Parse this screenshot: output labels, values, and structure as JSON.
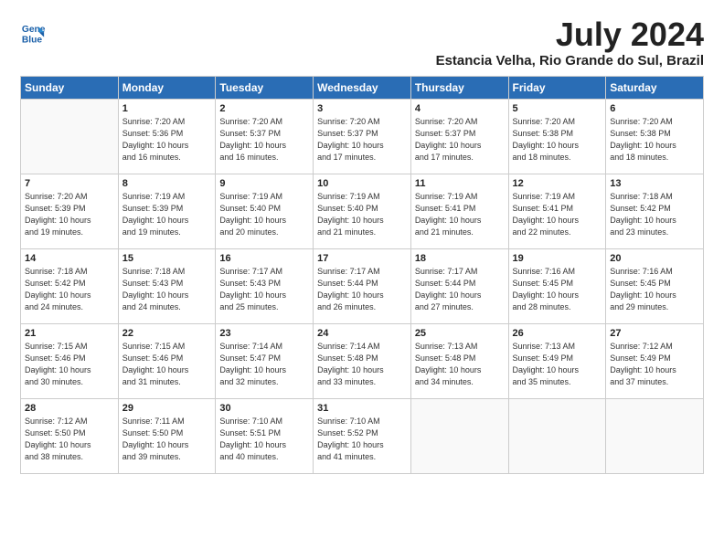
{
  "header": {
    "logo_line1": "General",
    "logo_line2": "Blue",
    "title": "July 2024",
    "location": "Estancia Velha, Rio Grande do Sul, Brazil"
  },
  "weekdays": [
    "Sunday",
    "Monday",
    "Tuesday",
    "Wednesday",
    "Thursday",
    "Friday",
    "Saturday"
  ],
  "weeks": [
    [
      {
        "day": "",
        "info": ""
      },
      {
        "day": "1",
        "info": "Sunrise: 7:20 AM\nSunset: 5:36 PM\nDaylight: 10 hours\nand 16 minutes."
      },
      {
        "day": "2",
        "info": "Sunrise: 7:20 AM\nSunset: 5:37 PM\nDaylight: 10 hours\nand 16 minutes."
      },
      {
        "day": "3",
        "info": "Sunrise: 7:20 AM\nSunset: 5:37 PM\nDaylight: 10 hours\nand 17 minutes."
      },
      {
        "day": "4",
        "info": "Sunrise: 7:20 AM\nSunset: 5:37 PM\nDaylight: 10 hours\nand 17 minutes."
      },
      {
        "day": "5",
        "info": "Sunrise: 7:20 AM\nSunset: 5:38 PM\nDaylight: 10 hours\nand 18 minutes."
      },
      {
        "day": "6",
        "info": "Sunrise: 7:20 AM\nSunset: 5:38 PM\nDaylight: 10 hours\nand 18 minutes."
      }
    ],
    [
      {
        "day": "7",
        "info": "Sunrise: 7:20 AM\nSunset: 5:39 PM\nDaylight: 10 hours\nand 19 minutes."
      },
      {
        "day": "8",
        "info": "Sunrise: 7:19 AM\nSunset: 5:39 PM\nDaylight: 10 hours\nand 19 minutes."
      },
      {
        "day": "9",
        "info": "Sunrise: 7:19 AM\nSunset: 5:40 PM\nDaylight: 10 hours\nand 20 minutes."
      },
      {
        "day": "10",
        "info": "Sunrise: 7:19 AM\nSunset: 5:40 PM\nDaylight: 10 hours\nand 21 minutes."
      },
      {
        "day": "11",
        "info": "Sunrise: 7:19 AM\nSunset: 5:41 PM\nDaylight: 10 hours\nand 21 minutes."
      },
      {
        "day": "12",
        "info": "Sunrise: 7:19 AM\nSunset: 5:41 PM\nDaylight: 10 hours\nand 22 minutes."
      },
      {
        "day": "13",
        "info": "Sunrise: 7:18 AM\nSunset: 5:42 PM\nDaylight: 10 hours\nand 23 minutes."
      }
    ],
    [
      {
        "day": "14",
        "info": "Sunrise: 7:18 AM\nSunset: 5:42 PM\nDaylight: 10 hours\nand 24 minutes."
      },
      {
        "day": "15",
        "info": "Sunrise: 7:18 AM\nSunset: 5:43 PM\nDaylight: 10 hours\nand 24 minutes."
      },
      {
        "day": "16",
        "info": "Sunrise: 7:17 AM\nSunset: 5:43 PM\nDaylight: 10 hours\nand 25 minutes."
      },
      {
        "day": "17",
        "info": "Sunrise: 7:17 AM\nSunset: 5:44 PM\nDaylight: 10 hours\nand 26 minutes."
      },
      {
        "day": "18",
        "info": "Sunrise: 7:17 AM\nSunset: 5:44 PM\nDaylight: 10 hours\nand 27 minutes."
      },
      {
        "day": "19",
        "info": "Sunrise: 7:16 AM\nSunset: 5:45 PM\nDaylight: 10 hours\nand 28 minutes."
      },
      {
        "day": "20",
        "info": "Sunrise: 7:16 AM\nSunset: 5:45 PM\nDaylight: 10 hours\nand 29 minutes."
      }
    ],
    [
      {
        "day": "21",
        "info": "Sunrise: 7:15 AM\nSunset: 5:46 PM\nDaylight: 10 hours\nand 30 minutes."
      },
      {
        "day": "22",
        "info": "Sunrise: 7:15 AM\nSunset: 5:46 PM\nDaylight: 10 hours\nand 31 minutes."
      },
      {
        "day": "23",
        "info": "Sunrise: 7:14 AM\nSunset: 5:47 PM\nDaylight: 10 hours\nand 32 minutes."
      },
      {
        "day": "24",
        "info": "Sunrise: 7:14 AM\nSunset: 5:48 PM\nDaylight: 10 hours\nand 33 minutes."
      },
      {
        "day": "25",
        "info": "Sunrise: 7:13 AM\nSunset: 5:48 PM\nDaylight: 10 hours\nand 34 minutes."
      },
      {
        "day": "26",
        "info": "Sunrise: 7:13 AM\nSunset: 5:49 PM\nDaylight: 10 hours\nand 35 minutes."
      },
      {
        "day": "27",
        "info": "Sunrise: 7:12 AM\nSunset: 5:49 PM\nDaylight: 10 hours\nand 37 minutes."
      }
    ],
    [
      {
        "day": "28",
        "info": "Sunrise: 7:12 AM\nSunset: 5:50 PM\nDaylight: 10 hours\nand 38 minutes."
      },
      {
        "day": "29",
        "info": "Sunrise: 7:11 AM\nSunset: 5:50 PM\nDaylight: 10 hours\nand 39 minutes."
      },
      {
        "day": "30",
        "info": "Sunrise: 7:10 AM\nSunset: 5:51 PM\nDaylight: 10 hours\nand 40 minutes."
      },
      {
        "day": "31",
        "info": "Sunrise: 7:10 AM\nSunset: 5:52 PM\nDaylight: 10 hours\nand 41 minutes."
      },
      {
        "day": "",
        "info": ""
      },
      {
        "day": "",
        "info": ""
      },
      {
        "day": "",
        "info": ""
      }
    ]
  ]
}
